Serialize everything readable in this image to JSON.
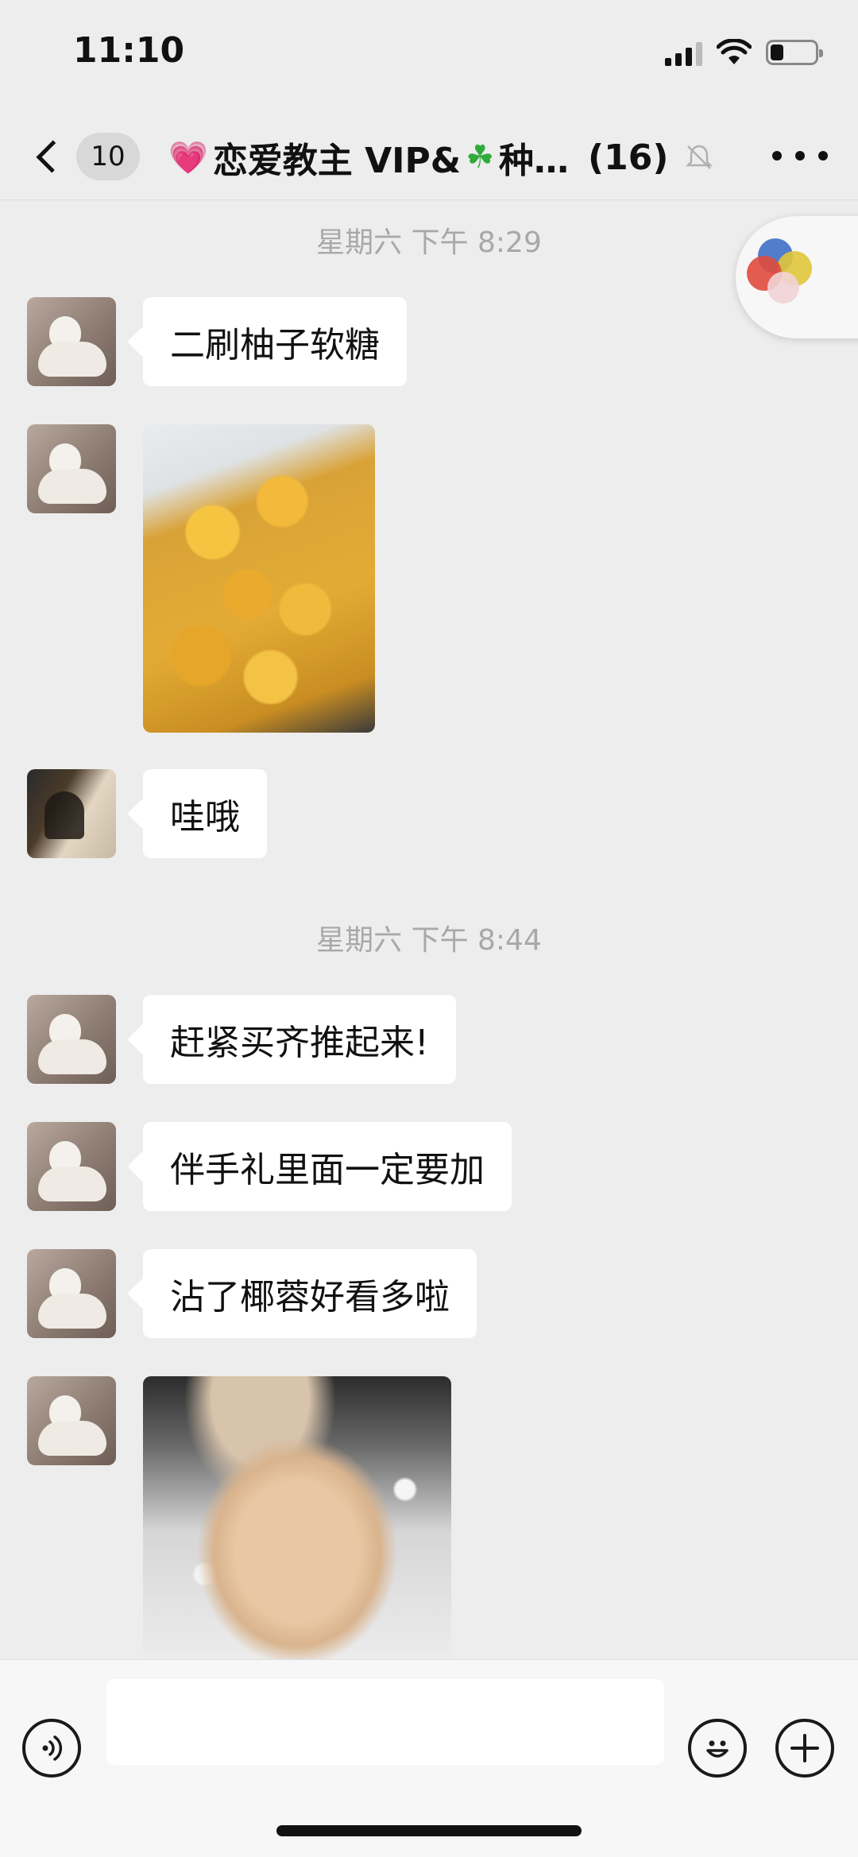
{
  "status_bar": {
    "time": "11:10",
    "icons": [
      "signal-icon",
      "wifi-icon",
      "battery-icon"
    ]
  },
  "nav": {
    "unread_count": "10",
    "title_part1": "恋爱教主 VIP&",
    "title_part2": "种…",
    "member_count": "(16)",
    "icons": [
      "back-chevron-icon",
      "heart-emoji-icon",
      "clover-emoji-icon",
      "mute-bell-icon",
      "more-icon"
    ]
  },
  "messages": [
    {
      "type": "timestamp",
      "text": "星期六 下午 8:29"
    },
    {
      "type": "text",
      "avatar": "cat-avatar",
      "text": "二刷柚子软糖"
    },
    {
      "type": "image",
      "avatar": "cat-avatar",
      "description_icon": "yuzu-candy-photo"
    },
    {
      "type": "text",
      "avatar": "shadow-avatar",
      "text": "哇哦"
    },
    {
      "type": "timestamp",
      "text": "星期六 下午 8:44"
    },
    {
      "type": "text",
      "avatar": "cat-avatar",
      "text": "赶紧买齐推起来!"
    },
    {
      "type": "text",
      "avatar": "cat-avatar",
      "text": "伴手礼里面一定要加"
    },
    {
      "type": "text",
      "avatar": "cat-avatar",
      "text": "沾了椰蓉好看多啦"
    },
    {
      "type": "image",
      "avatar": "cat-avatar",
      "description_icon": "coconut-candy-jar-photo"
    }
  ],
  "input_bar": {
    "value": "",
    "icons": [
      "voice-icon",
      "emoji-icon",
      "plus-icon"
    ]
  },
  "colors": {
    "background": "#ededed",
    "bubble": "#ffffff",
    "timestamp": "#a8a8a8",
    "heart": "#ff5da2",
    "clover": "#2faa3b"
  }
}
